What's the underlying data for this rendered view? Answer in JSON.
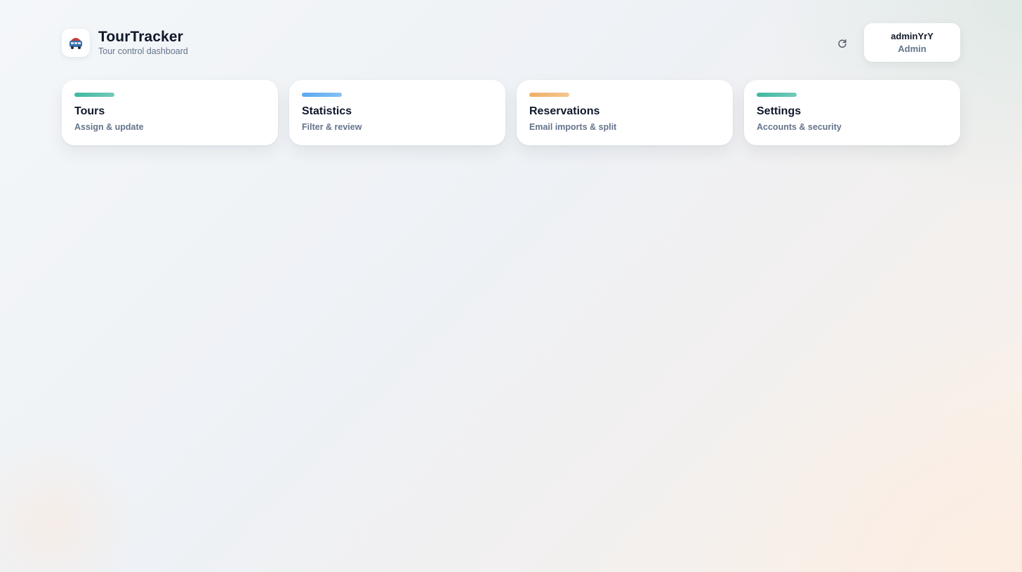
{
  "app": {
    "title": "TourTracker",
    "subtitle": "Tour control dashboard",
    "logo_icon": "bus-logo-icon"
  },
  "toolbar": {
    "refresh_icon": "refresh-icon"
  },
  "user": {
    "name": "adminYrY",
    "role": "Admin"
  },
  "cards": [
    {
      "title": "Tours",
      "description": "Assign & update",
      "accent": "#3fb7a1"
    },
    {
      "title": "Statistics",
      "description": "Filter & review",
      "accent": "#5aa9f0"
    },
    {
      "title": "Reservations",
      "description": "Email imports & split",
      "accent": "#efb066"
    },
    {
      "title": "Settings",
      "description": "Accounts & security",
      "accent": "#3fb7a1"
    }
  ]
}
